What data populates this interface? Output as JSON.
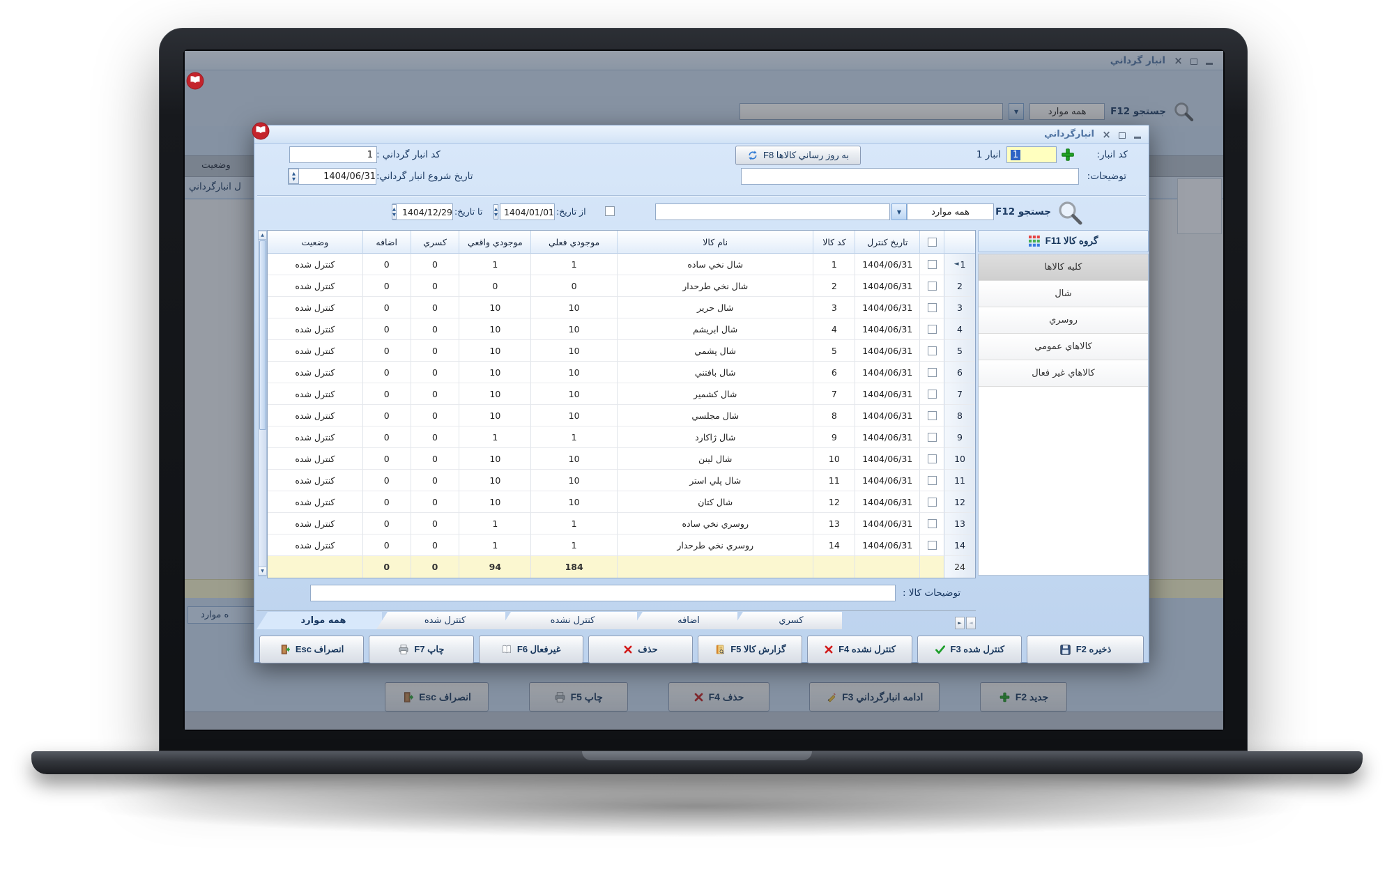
{
  "bg_window": {
    "title": "انبار گرداني",
    "search_label": "جستجو F12",
    "search_filter": "همه موارد",
    "search_value": "",
    "status_column_header": "وضعیت",
    "selected_row_fragment": "ل انبارگرداني",
    "tab_fragment": "ه موارد",
    "buttons": [
      {
        "label": "جدید F2",
        "icon": "plus-icon"
      },
      {
        "label": "ادامه انبارگرداني F3",
        "icon": "pencil-icon"
      },
      {
        "label": "حذف F4",
        "icon": "delete-x-icon"
      },
      {
        "label": "چاپ F5",
        "icon": "printer-icon"
      },
      {
        "label": "انصراف Esc",
        "icon": "exit-door-icon"
      }
    ]
  },
  "dialog": {
    "title": "انبارگرداني",
    "header": {
      "warehouse_code_label": "کد انبار:",
      "warehouse_code_value": "1",
      "warehouse_name": "انبار 1",
      "update_items_button": "به روز رساني کالاها F8",
      "stocktaking_code_label": "کد انبار گرداني :",
      "stocktaking_code_value": "1",
      "notes_label": "توضیحات:",
      "notes_value": "",
      "start_date_label": "تاریخ شروع انبار گرداني:",
      "start_date_value": "1404/06/31"
    },
    "filter": {
      "search_label": "جستجو F12",
      "search_filter": "همه موارد",
      "search_value": "",
      "from_date_label": "از تاریخ:",
      "from_date_value": "1404/01/01",
      "to_date_label": "تا تاریخ:",
      "to_date_value": "1404/12/29"
    },
    "sidebar": {
      "header": "گروه کالا F11",
      "selected": "کلیه کالاها",
      "items": [
        "کلیه کالاها",
        "شال",
        "روسري",
        "کالاهاي عمومي",
        "کالاهاي غیر فعال"
      ]
    },
    "table": {
      "columns": [
        "وضعیت",
        "اضافه",
        "کسري",
        "موجودي واقعي",
        "موجودي فعلي",
        "نام کالا",
        "کد کالا",
        "تاریخ کنترل"
      ],
      "rows": [
        {
          "num": "1",
          "date": "1404/06/31",
          "code": "1",
          "name": "شال نخي ساده",
          "current": "1",
          "actual": "1",
          "shortage": "0",
          "surplus": "0",
          "status": "کنترل شده",
          "current_row": true
        },
        {
          "num": "2",
          "date": "1404/06/31",
          "code": "2",
          "name": "شال نخي طرحدار",
          "current": "0",
          "actual": "0",
          "shortage": "0",
          "surplus": "0",
          "status": "کنترل شده"
        },
        {
          "num": "3",
          "date": "1404/06/31",
          "code": "3",
          "name": "شال حریر",
          "current": "10",
          "actual": "10",
          "shortage": "0",
          "surplus": "0",
          "status": "کنترل شده"
        },
        {
          "num": "4",
          "date": "1404/06/31",
          "code": "4",
          "name": "شال ابریشم",
          "current": "10",
          "actual": "10",
          "shortage": "0",
          "surplus": "0",
          "status": "کنترل شده"
        },
        {
          "num": "5",
          "date": "1404/06/31",
          "code": "5",
          "name": "شال پشمي",
          "current": "10",
          "actual": "10",
          "shortage": "0",
          "surplus": "0",
          "status": "کنترل شده"
        },
        {
          "num": "6",
          "date": "1404/06/31",
          "code": "6",
          "name": "شال بافتني",
          "current": "10",
          "actual": "10",
          "shortage": "0",
          "surplus": "0",
          "status": "کنترل شده"
        },
        {
          "num": "7",
          "date": "1404/06/31",
          "code": "7",
          "name": "شال کشمیر",
          "current": "10",
          "actual": "10",
          "shortage": "0",
          "surplus": "0",
          "status": "کنترل شده"
        },
        {
          "num": "8",
          "date": "1404/06/31",
          "code": "8",
          "name": "شال مجلسي",
          "current": "10",
          "actual": "10",
          "shortage": "0",
          "surplus": "0",
          "status": "کنترل شده"
        },
        {
          "num": "9",
          "date": "1404/06/31",
          "code": "9",
          "name": "شال ژاکارد",
          "current": "1",
          "actual": "1",
          "shortage": "0",
          "surplus": "0",
          "status": "کنترل شده"
        },
        {
          "num": "10",
          "date": "1404/06/31",
          "code": "10",
          "name": "شال لینن",
          "current": "10",
          "actual": "10",
          "shortage": "0",
          "surplus": "0",
          "status": "کنترل شده"
        },
        {
          "num": "11",
          "date": "1404/06/31",
          "code": "11",
          "name": "شال پلي استر",
          "current": "10",
          "actual": "10",
          "shortage": "0",
          "surplus": "0",
          "status": "کنترل شده"
        },
        {
          "num": "12",
          "date": "1404/06/31",
          "code": "12",
          "name": "شال کتان",
          "current": "10",
          "actual": "10",
          "shortage": "0",
          "surplus": "0",
          "status": "کنترل شده"
        },
        {
          "num": "13",
          "date": "1404/06/31",
          "code": "13",
          "name": "روسري نخي ساده",
          "current": "1",
          "actual": "1",
          "shortage": "0",
          "surplus": "0",
          "status": "کنترل شده"
        },
        {
          "num": "14",
          "date": "1404/06/31",
          "code": "14",
          "name": "روسري نخي طرحدار",
          "current": "1",
          "actual": "1",
          "shortage": "0",
          "surplus": "0",
          "status": "کنترل شده"
        }
      ],
      "totals": {
        "surplus": "0",
        "shortage": "0",
        "actual": "94",
        "current": "184",
        "row_count": "24"
      }
    },
    "item_notes_label": "توضیحات کالا :",
    "item_notes_value": "",
    "tabs": [
      "همه موارد",
      "کنترل شده",
      "کنترل نشده",
      "اضافه",
      "کسري"
    ],
    "active_tab": "همه موارد",
    "buttons": [
      {
        "label": "ذخیره F2",
        "icon": "save-icon"
      },
      {
        "label": "کنترل شده F3",
        "icon": "check-icon"
      },
      {
        "label": "کنترل نشده F4",
        "icon": "x-icon"
      },
      {
        "label": "گزارش کالا F5",
        "icon": "report-icon"
      },
      {
        "label": "حذف",
        "icon": "x-icon"
      },
      {
        "label": "غیرفعال F6",
        "icon": "book-icon"
      },
      {
        "label": "چاپ F7",
        "icon": "printer-icon"
      },
      {
        "label": "انصراف Esc",
        "icon": "exit-door-icon"
      }
    ]
  }
}
